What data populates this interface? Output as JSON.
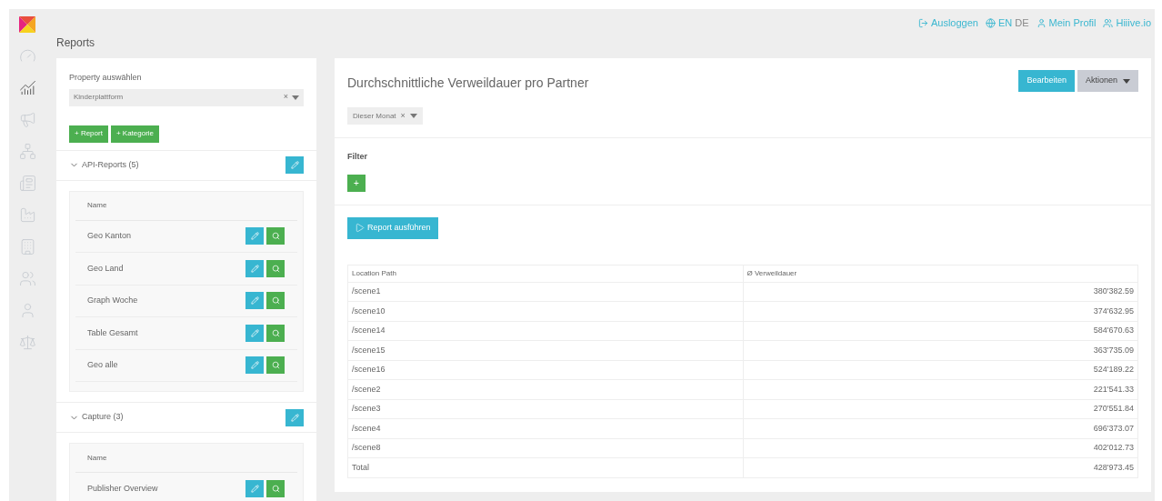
{
  "sidebar": {
    "items": [
      {
        "selected": false
      },
      {
        "selected": true
      },
      {
        "selected": false
      },
      {
        "selected": false
      },
      {
        "selected": false
      },
      {
        "selected": false
      },
      {
        "selected": false
      },
      {
        "selected": false
      },
      {
        "selected": false
      },
      {
        "selected": false
      }
    ]
  },
  "topbar": {
    "logout": "Ausloggen",
    "languages": [
      {
        "label": "EN",
        "selected": true
      },
      {
        "label": "DE",
        "selected": false
      }
    ],
    "profile": "Mein Profil",
    "site": "Hiiive.io"
  },
  "page_title": "Reports",
  "left_panel": {
    "property_label": "Property auswählen",
    "property_value": "Kinderplattform",
    "clear": "×",
    "buttons": [
      "+ Report",
      "+ Kategorie"
    ],
    "categories": [
      {
        "title": "API-Reports (5)",
        "expanded": true,
        "column": "Name",
        "reports": [
          "Geo Kanton",
          "Geo Land",
          "Graph Woche",
          "Table Gesamt",
          "Geo alle"
        ]
      },
      {
        "title": "Capture (3)",
        "expanded": true,
        "column": "Name",
        "reports": [
          "Publisher Overview"
        ]
      }
    ]
  },
  "report": {
    "title": "Durchschnittliche Verweildauer pro Partner",
    "edit_button": "Bearbeiten",
    "actions_button": "Aktionen",
    "period": "Dieser Monat",
    "clear": "×",
    "filter_label": "Filter",
    "add_filter": "+",
    "run_button": "Report ausführen",
    "table": {
      "columns": [
        "Location Path",
        "Ø Verweildauer"
      ],
      "rows": [
        [
          "/scene1",
          "380'382.59"
        ],
        [
          "/scene10",
          "374'632.95"
        ],
        [
          "/scene14",
          "584'670.63"
        ],
        [
          "/scene15",
          "363'735.09"
        ],
        [
          "/scene16",
          "524'189.22"
        ],
        [
          "/scene2",
          "221'541.33"
        ],
        [
          "/scene3",
          "270'551.84"
        ],
        [
          "/scene4",
          "696'373.07"
        ],
        [
          "/scene8",
          "402'012.73"
        ],
        [
          "Total",
          "428'973.45"
        ]
      ]
    }
  }
}
